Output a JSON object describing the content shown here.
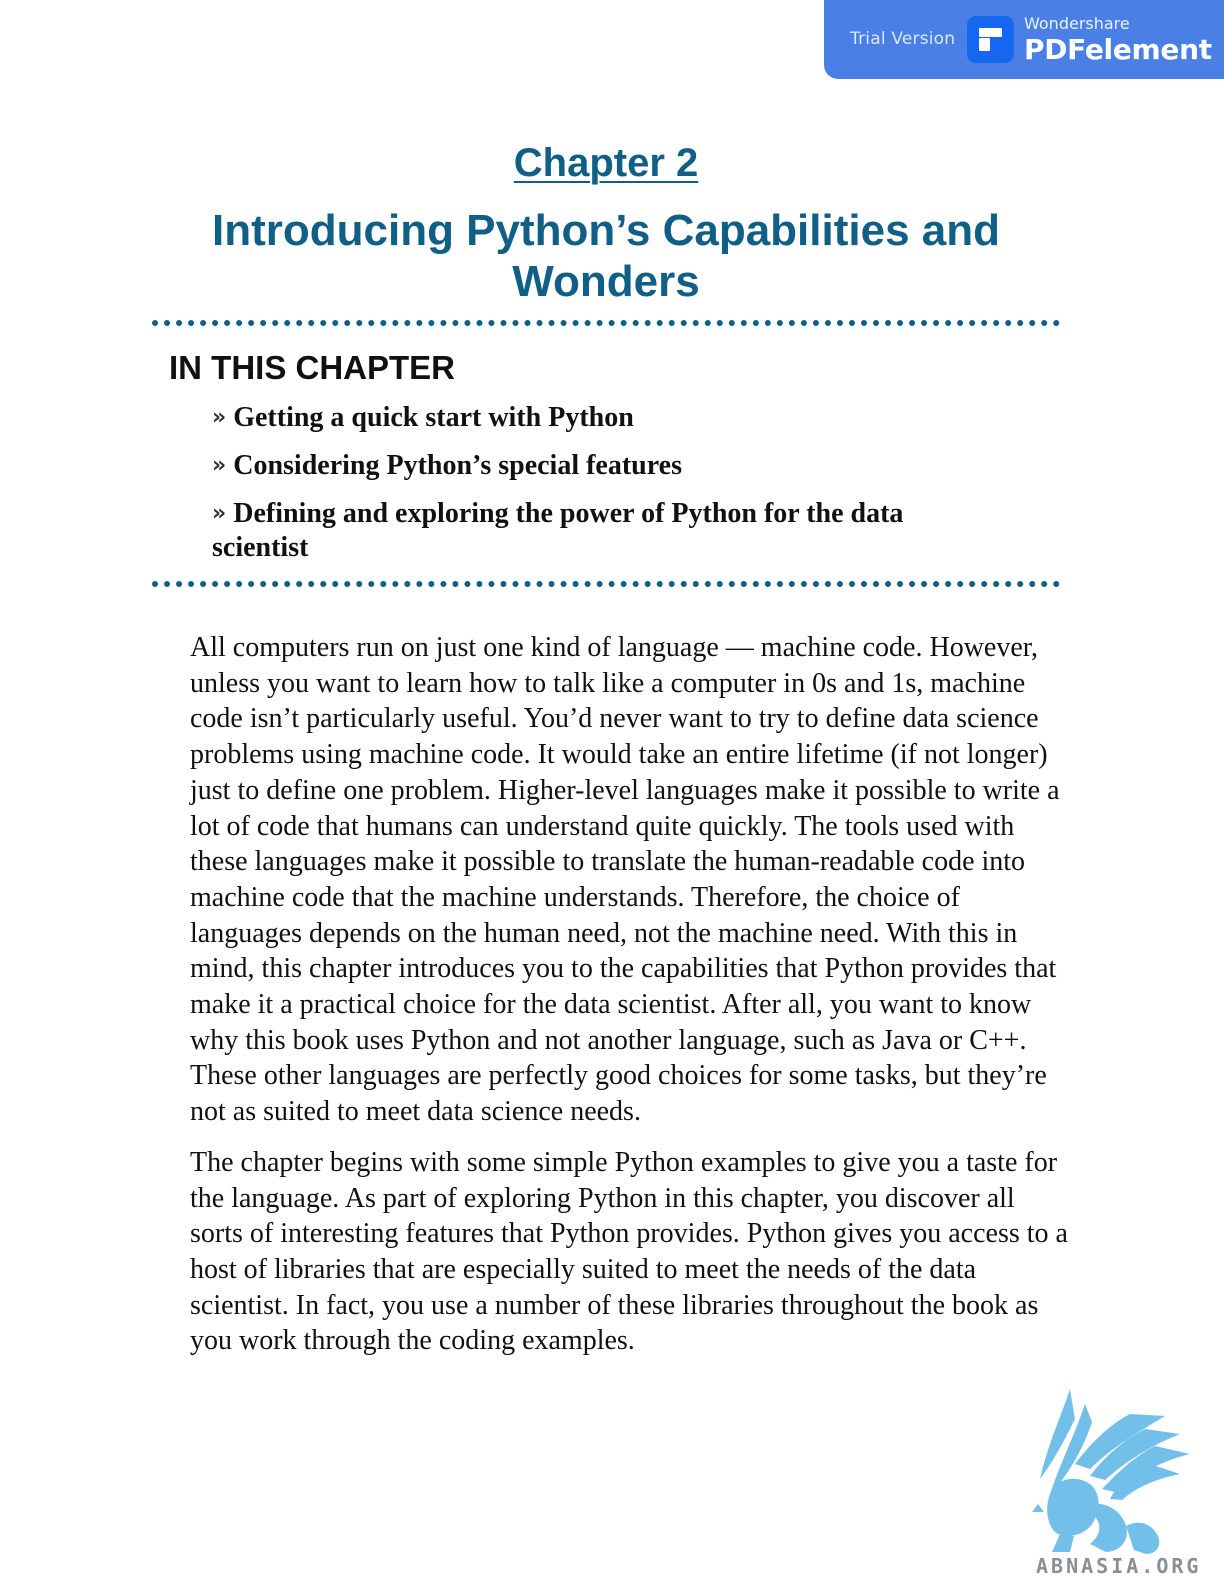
{
  "trial_badge": {
    "trial_label": "Trial Version",
    "brand_top": "Wondershare",
    "brand_main": "PDFelement",
    "color": "#4a7fe6"
  },
  "chapter": {
    "number_label": "Chapter 2",
    "title": "Introducing Python’s Capabilities and Wonders",
    "accent_color": "#0f5f86"
  },
  "in_this_chapter": {
    "heading": "IN THIS CHAPTER",
    "items": [
      "Getting a quick start with Python",
      "Considering Python’s special features",
      "Defining and exploring the power of Python for the data scientist"
    ],
    "bullet_icon": "double-chevron-right-icon"
  },
  "body": {
    "paragraphs": [
      "All computers run on just one kind of language — machine code. However, unless you want to learn how to talk like a computer in 0s and 1s, machine code isn’t particularly useful. You’d never want to try to define data science problems using machine code. It would take an entire lifetime (if not longer) just to define one problem. Higher-level languages make it possible to write a lot of code that humans can understand quite quickly. The tools used with these languages make it possible to translate the human-readable code into machine code that the machine understands. Therefore, the choice of languages depends on the human need, not the machine need. With this in mind, this chapter introduces you to the capabilities that Python provides that make it a practical choice for the data scientist. After all, you want to know why this book uses Python and not another language, such as Java or C++. These other languages are perfectly good choices for some tasks, but they’re not as suited to meet data science needs.",
      "The chapter begins with some simple Python examples to give you a taste for the language. As part of exploring Python in this chapter, you discover all sorts of interesting features that Python provides. Python gives you access to a host of libraries that are especially suited to meet the needs of the data scientist. In fact, you use a number of these libraries throughout the book as you work through the coding examples."
    ]
  },
  "watermark": {
    "text": "ABNASIA.ORG",
    "icon": "griffin-logo-icon"
  }
}
